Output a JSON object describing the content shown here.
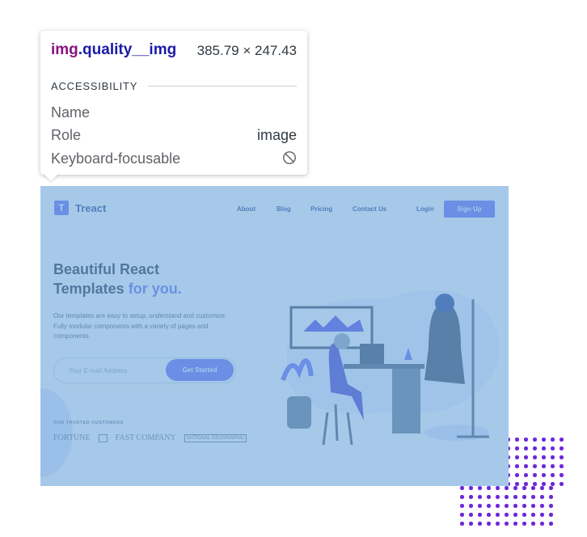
{
  "tooltip": {
    "tag": "img",
    "class": ".quality__img",
    "size": "385.79 × 247.43",
    "section": "ACCESSIBILITY",
    "rows": [
      {
        "label": "Name",
        "value": ""
      },
      {
        "label": "Role",
        "value": "image"
      },
      {
        "label": "Keyboard-focusable",
        "value": ""
      }
    ],
    "focusable_icon": "not-allowed-icon"
  },
  "screenshot": {
    "brand": {
      "mark": "T",
      "name": "Treact"
    },
    "nav": [
      "About",
      "Blog",
      "Pricing",
      "Contact Us"
    ],
    "login": "Login",
    "signup": "Sign Up",
    "hero": {
      "title_line1": "Beautiful React",
      "title_line2": "Templates ",
      "title_accent": "for you.",
      "description": "Our templates are easy to setup, understand and customize. Fully modular components with a variety of pages and components.",
      "email_placeholder": "Your E-mail Address",
      "cta": "Get Started"
    },
    "trusted": {
      "heading": "OUR TRUSTED CUSTOMERS",
      "brands": [
        "FORTUNE",
        "FAST COMPANY",
        "NATIONAL GEOGRAPHIC"
      ]
    },
    "illustration_icon": "woman-at-desk-illustration",
    "overlay_color": "#6fa8dc"
  },
  "colors": {
    "accent": "#6366f1",
    "dots": "#6d28d9"
  }
}
